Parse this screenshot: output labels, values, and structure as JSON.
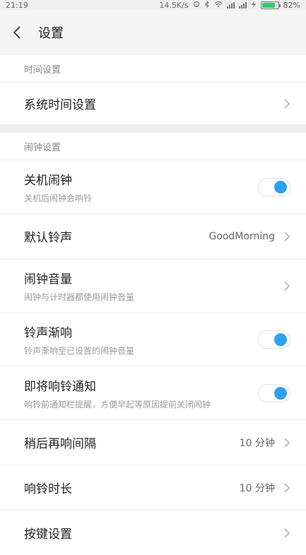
{
  "status_bar": {
    "time": "21:19",
    "speed": "14.5K/s",
    "battery": "82%",
    "battery_level": 0.82
  },
  "header": {
    "title": "设置",
    "back_icon": "chevron-left-icon"
  },
  "sections": {
    "time": {
      "header": "时间设置",
      "items": [
        {
          "title": "系统时间设置"
        }
      ]
    },
    "alarm": {
      "header": "闹钟设置",
      "items": [
        {
          "title": "关机闹钟",
          "subtitle": "关机后闹钟会响铃",
          "toggle_on": true
        },
        {
          "title": "默认铃声",
          "value": "GoodMorning"
        },
        {
          "title": "闹钟音量",
          "subtitle": "闹钟与计时器都使用闹钟音量"
        },
        {
          "title": "铃声渐响",
          "subtitle": "铃声渐响至已设置的闹钟音量",
          "toggle_on": true
        },
        {
          "title": "即将响铃通知",
          "subtitle": "响铃前通知栏提醒，方便早起等原因提前关闭闹钟",
          "toggle_on": true
        },
        {
          "title": "稍后再响间隔",
          "value": "10 分钟"
        },
        {
          "title": "响铃时长",
          "value": "10 分钟"
        },
        {
          "title": "按键设置"
        }
      ]
    }
  },
  "colors": {
    "accent": "#2f9ff0",
    "background": "#f4f4f4",
    "card": "#ffffff"
  }
}
